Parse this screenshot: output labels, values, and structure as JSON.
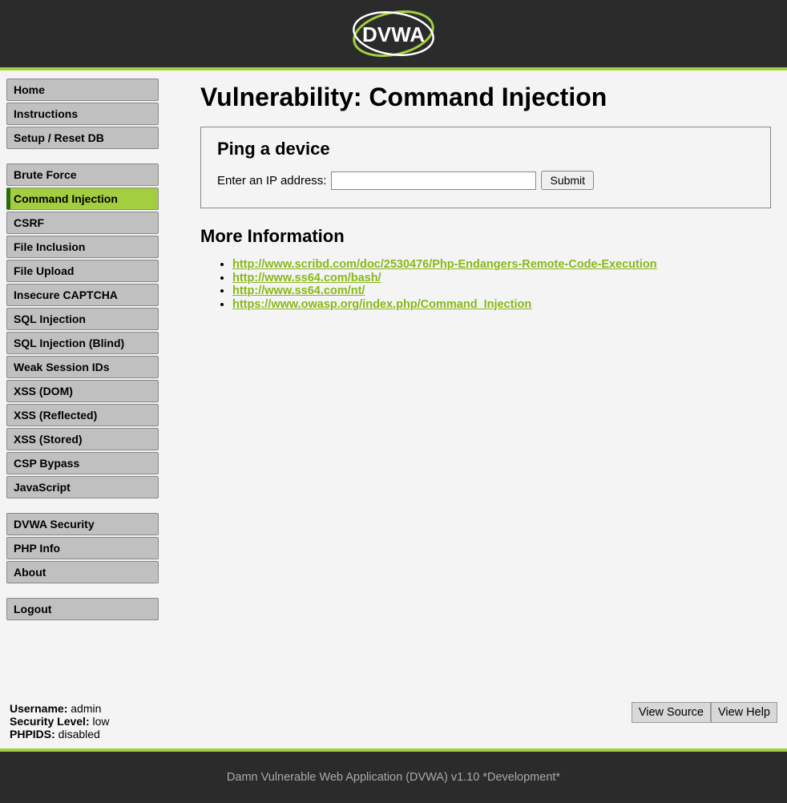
{
  "header": {
    "logo_text": "DVWA"
  },
  "sidebar": {
    "groups": [
      {
        "items": [
          {
            "label": "Home",
            "selected": false
          },
          {
            "label": "Instructions",
            "selected": false
          },
          {
            "label": "Setup / Reset DB",
            "selected": false
          }
        ]
      },
      {
        "items": [
          {
            "label": "Brute Force",
            "selected": false
          },
          {
            "label": "Command Injection",
            "selected": true
          },
          {
            "label": "CSRF",
            "selected": false
          },
          {
            "label": "File Inclusion",
            "selected": false
          },
          {
            "label": "File Upload",
            "selected": false
          },
          {
            "label": "Insecure CAPTCHA",
            "selected": false
          },
          {
            "label": "SQL Injection",
            "selected": false
          },
          {
            "label": "SQL Injection (Blind)",
            "selected": false
          },
          {
            "label": "Weak Session IDs",
            "selected": false
          },
          {
            "label": "XSS (DOM)",
            "selected": false
          },
          {
            "label": "XSS (Reflected)",
            "selected": false
          },
          {
            "label": "XSS (Stored)",
            "selected": false
          },
          {
            "label": "CSP Bypass",
            "selected": false
          },
          {
            "label": "JavaScript",
            "selected": false
          }
        ]
      },
      {
        "items": [
          {
            "label": "DVWA Security",
            "selected": false
          },
          {
            "label": "PHP Info",
            "selected": false
          },
          {
            "label": "About",
            "selected": false
          }
        ]
      },
      {
        "items": [
          {
            "label": "Logout",
            "selected": false
          }
        ]
      }
    ]
  },
  "main": {
    "title": "Vulnerability: Command Injection",
    "form": {
      "heading": "Ping a device",
      "label": "Enter an IP address:",
      "value": "",
      "submit": "Submit"
    },
    "more_info": {
      "heading": "More Information",
      "links": [
        "http://www.scribd.com/doc/2530476/Php-Endangers-Remote-Code-Execution",
        "http://www.ss64.com/bash/",
        "http://www.ss64.com/nt/",
        "https://www.owasp.org/index.php/Command_Injection"
      ]
    }
  },
  "status": {
    "username_label": "Username:",
    "username_value": " admin",
    "security_label": "Security Level:",
    "security_value": " low",
    "phpids_label": "PHPIDS:",
    "phpids_value": " disabled"
  },
  "buttons": {
    "view_source": "View Source",
    "view_help": "View Help"
  },
  "footer": {
    "text": "Damn Vulnerable Web Application (DVWA) v1.10 *Development*"
  }
}
